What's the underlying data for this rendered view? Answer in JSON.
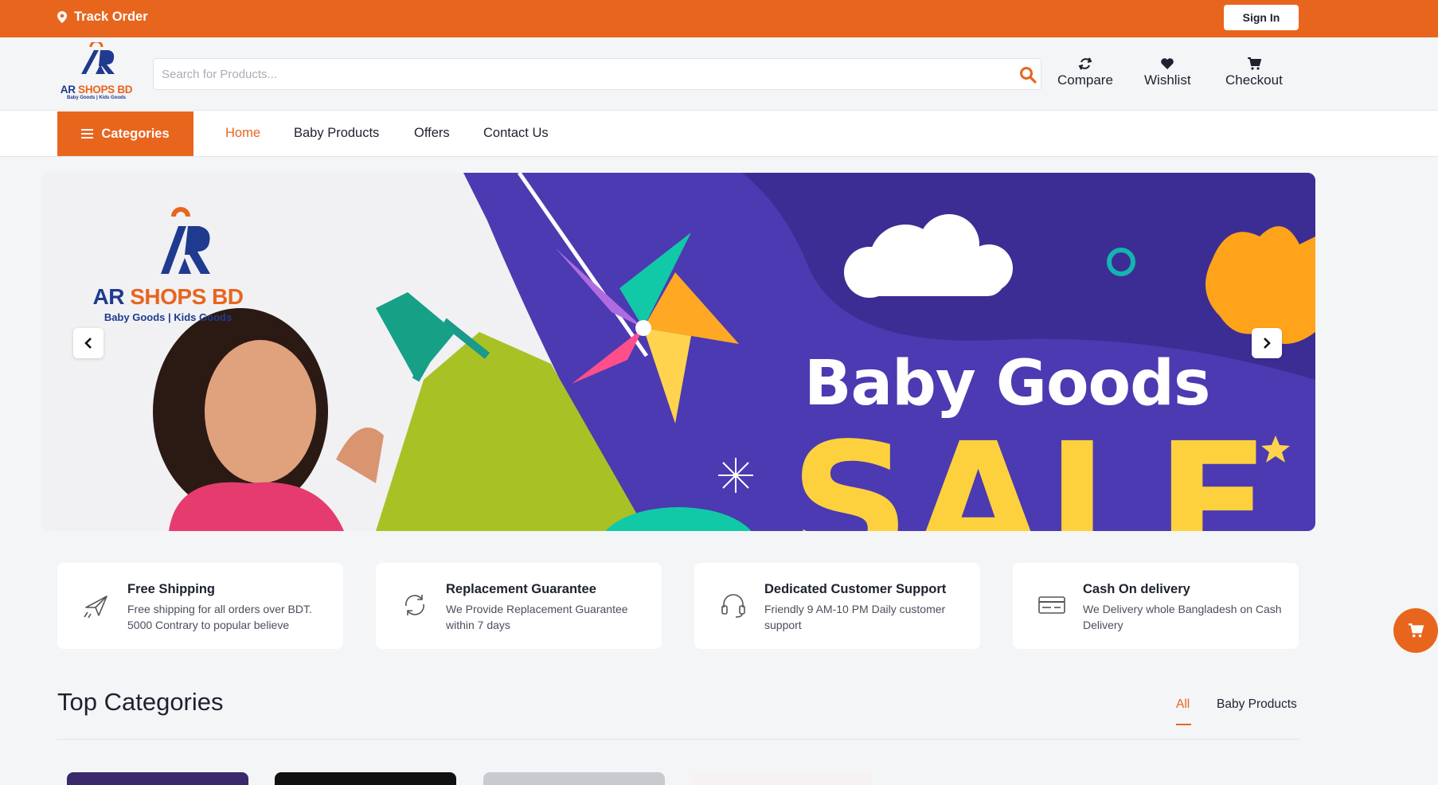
{
  "topbar": {
    "track_order": "Track Order",
    "sign_in": "Sign In"
  },
  "logo": {
    "name_a": "AR",
    "name_b": "SHOPS BD",
    "tagline": "Baby Goods | Kids Goods"
  },
  "search": {
    "placeholder": "Search for Products..."
  },
  "header_actions": [
    {
      "label": "Compare",
      "icon": "compare-icon"
    },
    {
      "label": "Wishlist",
      "icon": "heart-icon"
    },
    {
      "label": "Checkout",
      "icon": "cart-icon"
    }
  ],
  "nav": {
    "categories": "Categories",
    "links": [
      "Home",
      "Baby Products",
      "Offers",
      "Contact Us"
    ],
    "active": "Home"
  },
  "banner": {
    "brand_a": "AR",
    "brand_b": "SHOPS BD",
    "brand_sub": "Baby Goods | Kids Goods",
    "headline": "Baby Goods",
    "sale": "SALE"
  },
  "features": [
    {
      "title": "Free Shipping",
      "desc": "Free shipping for all orders over BDT. 5000 Contrary to popular believe",
      "icon": "airplane-icon"
    },
    {
      "title": "Replacement Guarantee",
      "desc": "We Provide Replacement Guarantee within 7 days",
      "icon": "refresh-icon"
    },
    {
      "title": "Dedicated Customer Support",
      "desc": "Friendly 9 AM-10 PM Daily customer support",
      "icon": "headset-icon"
    },
    {
      "title": "Cash On delivery",
      "desc": "We Delivery whole Bangladesh on Cash Delivery",
      "icon": "credit-card-icon"
    }
  ],
  "top_categories": {
    "title": "Top Categories",
    "tabs": [
      "All",
      "Baby Products"
    ],
    "active": "All"
  },
  "colors": {
    "accent": "#e8651e",
    "brand_blue": "#1f3a8f",
    "banner_purple": "#4b3ab1",
    "sale_yellow": "#fcd13d"
  }
}
